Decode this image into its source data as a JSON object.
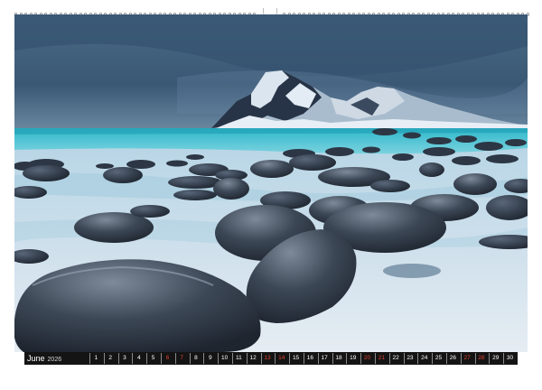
{
  "calendar": {
    "month": "June",
    "year": "2026",
    "days": [
      "1",
      "2",
      "3",
      "4",
      "5",
      "6",
      "7",
      "8",
      "9",
      "10",
      "11",
      "12",
      "13",
      "14",
      "15",
      "16",
      "17",
      "18",
      "19",
      "20",
      "21",
      "22",
      "23",
      "24",
      "25",
      "26",
      "27",
      "28",
      "29",
      "30"
    ],
    "weekend_days": [
      "6",
      "7",
      "13",
      "14",
      "20",
      "21",
      "27",
      "28"
    ],
    "weekend_color": "#e0402f"
  },
  "photo": {
    "subject": "rounded dark boulders on a snowy beach beside a turquoise sea with a snow-capped mountain under an overcast blue sky",
    "palette": {
      "sky": "#3f5d7a",
      "sea": "#39b9c9",
      "snow": "#dde8f0",
      "rock": "#2a3340"
    }
  }
}
